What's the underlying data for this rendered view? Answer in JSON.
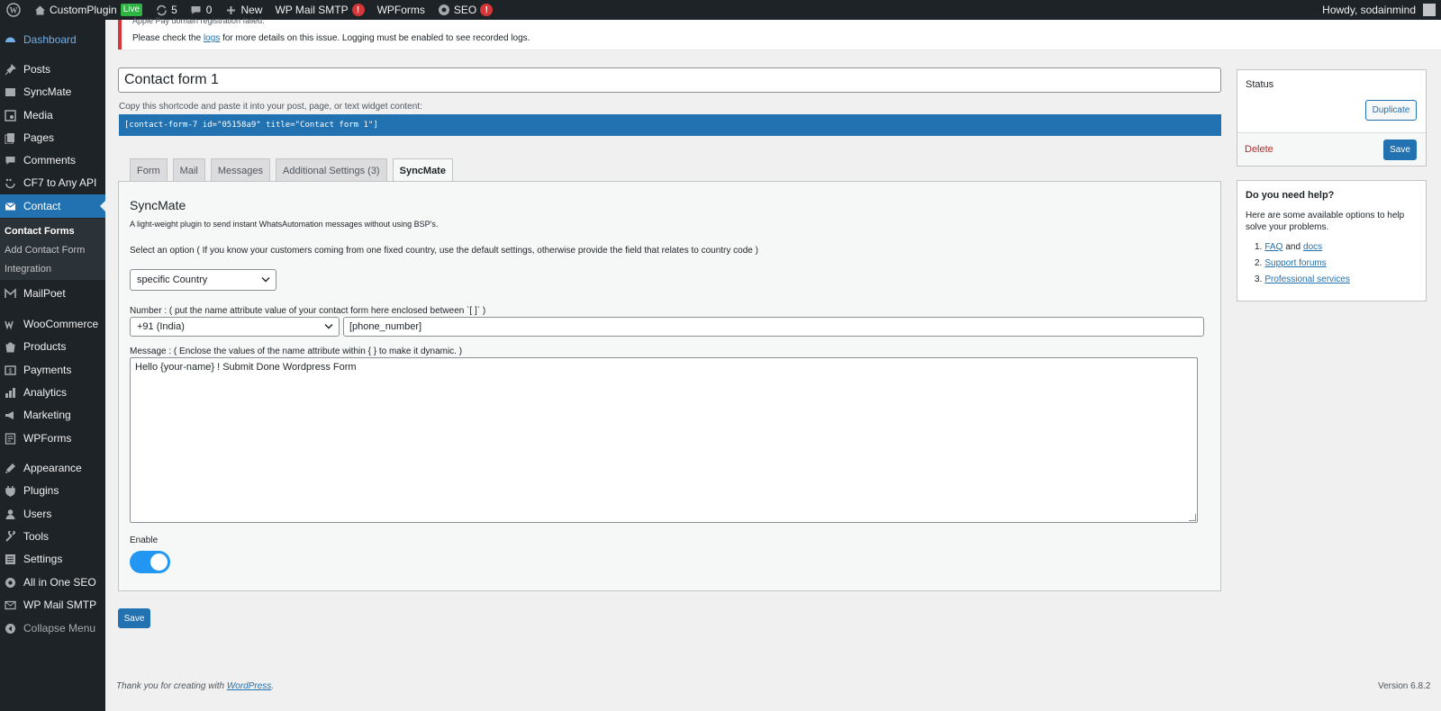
{
  "adminbar": {
    "site_name": "CustomPlugin",
    "live_badge": "Live",
    "updates_count": "5",
    "comments_count": "0",
    "new_label": "New",
    "smtp_label": "WP Mail SMTP",
    "smtp_badge": "!",
    "wpforms_label": "WPForms",
    "seo_label": "SEO",
    "seo_badge": "!",
    "howdy": "Howdy, sodainmind"
  },
  "sidebar": {
    "items": [
      {
        "label": "Dashboard",
        "icon": "dashboard-icon"
      },
      {
        "label": "Posts",
        "icon": "pin-icon"
      },
      {
        "label": "SyncMate",
        "icon": "syncmate-icon"
      },
      {
        "label": "Media",
        "icon": "media-icon"
      },
      {
        "label": "Pages",
        "icon": "pages-icon"
      },
      {
        "label": "Comments",
        "icon": "comments-icon"
      },
      {
        "label": "CF7 to Any API",
        "icon": "api-icon"
      },
      {
        "label": "Contact",
        "icon": "mail-icon"
      },
      {
        "label": "MailPoet",
        "icon": "mailpoet-icon"
      },
      {
        "label": "WooCommerce",
        "icon": "woocommerce-icon"
      },
      {
        "label": "Products",
        "icon": "products-icon"
      },
      {
        "label": "Payments",
        "icon": "payments-icon"
      },
      {
        "label": "Analytics",
        "icon": "analytics-icon"
      },
      {
        "label": "Marketing",
        "icon": "marketing-icon"
      },
      {
        "label": "WPForms",
        "icon": "wpforms-icon"
      },
      {
        "label": "Appearance",
        "icon": "appearance-icon"
      },
      {
        "label": "Plugins",
        "icon": "plugins-icon"
      },
      {
        "label": "Users",
        "icon": "users-icon"
      },
      {
        "label": "Tools",
        "icon": "tools-icon"
      },
      {
        "label": "Settings",
        "icon": "settings-icon"
      },
      {
        "label": "All in One SEO",
        "icon": "seo-icon"
      },
      {
        "label": "WP Mail SMTP",
        "icon": "smtp-icon"
      },
      {
        "label": "Collapse Menu",
        "icon": "collapse-icon"
      }
    ],
    "submenu": [
      "Contact Forms",
      "Add Contact Form",
      "Integration"
    ]
  },
  "notice": {
    "cut_text": "Apple Pay domain registration failed.",
    "msg_before": "Please check the",
    "msg_link": "logs",
    "msg_after": "for more details on this issue. Logging must be enabled to see recorded logs."
  },
  "form": {
    "title": "Contact form 1",
    "shortcode_label": "Copy this shortcode and paste it into your post, page, or text widget content:",
    "shortcode": "[contact-form-7 id=\"05158a9\" title=\"Contact form 1\"]"
  },
  "tabs": [
    "Form",
    "Mail",
    "Messages",
    "Additional Settings (3)",
    "SyncMate"
  ],
  "syncmate": {
    "heading": "SyncMate",
    "description": "A light-weight plugin to send instant WhatsAutomation messages without using BSP's.",
    "select_label": "Select an option ( If you know your customers coming from one fixed country, use the default settings, otherwise provide the field that relates to country code )",
    "select_value": "specific Country",
    "number_label": "Number : ( put the name attribute value of your contact form here enclosed between `[ ]` )",
    "country_value": "+91 (India)",
    "number_value": "[phone_number]",
    "message_label": "Message : ( Enclose the values of the name attribute within { } to make it dynamic. )",
    "message_value": "Hello {your-name} ! Submit Done Wordpress Form",
    "enable_label": "Enable",
    "enabled": true,
    "save_label": "Save"
  },
  "status_box": {
    "title": "Status",
    "duplicate_label": "Duplicate",
    "delete_label": "Delete",
    "save_label": "Save"
  },
  "help_box": {
    "title": "Do you need help?",
    "text": "Here are some available options to help solve your problems.",
    "items": [
      {
        "num": "1.",
        "link1": "FAQ",
        "and": "and",
        "link2": "docs"
      },
      {
        "num": "2.",
        "link1": "Support forums"
      },
      {
        "num": "3.",
        "link1": "Professional services"
      }
    ]
  },
  "footer": {
    "thanks_before": "Thank you for creating with",
    "thanks_link": "WordPress",
    "thanks_after": ".",
    "version": "Version 6.8.2"
  },
  "colors": {
    "admin_dark": "#1d2327",
    "accent_blue": "#2271b1",
    "toggle_blue": "#2196f3",
    "error_red": "#d63638"
  }
}
